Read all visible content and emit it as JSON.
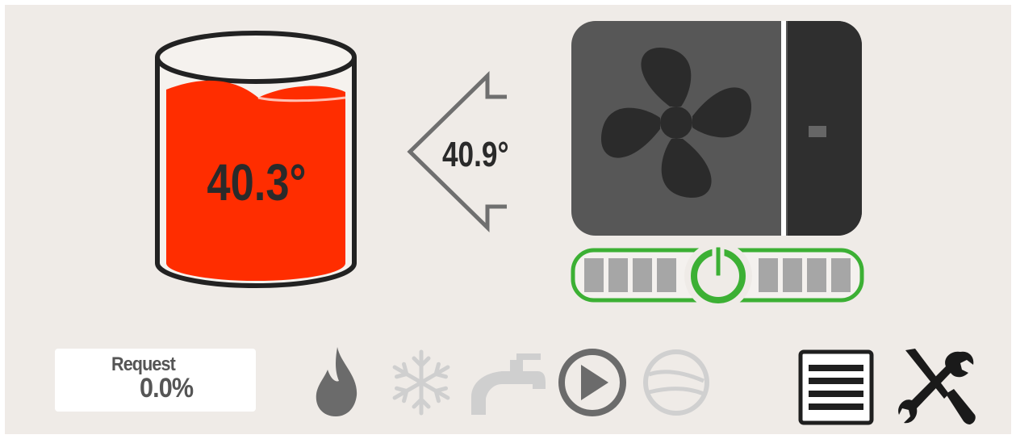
{
  "tank": {
    "temperature": "40.3°"
  },
  "flow": {
    "temperature": "40.9°"
  },
  "heat_pump": {
    "power_state": "on"
  },
  "request": {
    "label": "Request",
    "value": "0.0%"
  },
  "icons": {
    "tank": "water-tank-icon",
    "flow": "flow-arrow-icon",
    "heat_pump": "heat-pump-fan-icon",
    "power": "power-button-icon",
    "heating": "flame-icon",
    "cooling": "snowflake-icon",
    "hot_water": "faucet-icon",
    "circulation_pump": "pump-icon",
    "compressor": "compressor-icon",
    "menu": "menu-icon",
    "settings": "tools-icon"
  },
  "colors": {
    "water": "#ff2d00",
    "power_on": "#3cb034",
    "active_icon": "#6b6b6b",
    "inactive_icon": "#cfcfcf"
  }
}
